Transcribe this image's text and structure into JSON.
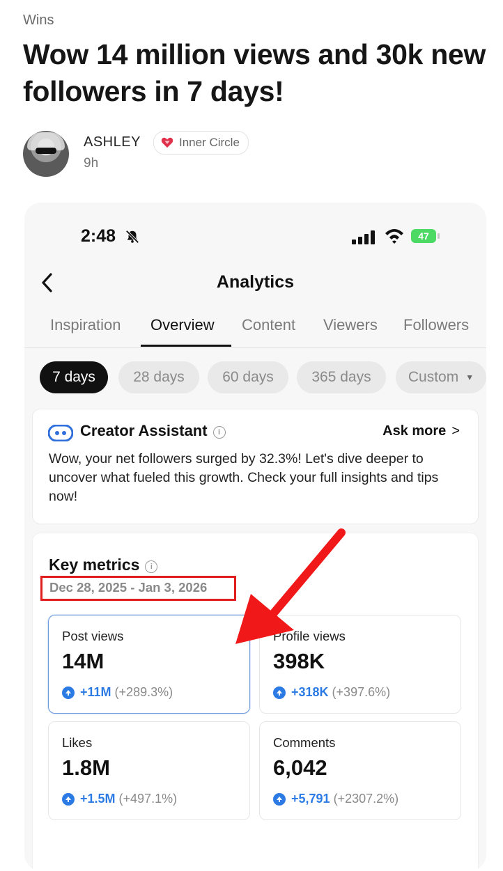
{
  "post": {
    "category": "Wins",
    "title": "Wow 14 million views and 30k new followers in 7 days!",
    "author": "ASHLEY",
    "badge": "Inner Circle",
    "time": "9h"
  },
  "phone": {
    "status": {
      "time": "2:48",
      "battery": "47"
    },
    "nav_title": "Analytics",
    "tabs": [
      "Inspiration",
      "Overview",
      "Content",
      "Viewers",
      "Followers"
    ],
    "active_tab": "Overview",
    "range_chips": [
      "7 days",
      "28 days",
      "60 days",
      "365 days",
      "Custom"
    ],
    "active_range": "7 days",
    "assistant": {
      "title": "Creator Assistant",
      "ask_more": "Ask more",
      "message": "Wow, your net followers surged by 32.3%! Let's dive deeper to uncover what fueled this growth. Check your full insights and tips now!"
    },
    "key_metrics": {
      "title": "Key metrics",
      "date_range": "Dec 28, 2025 - Jan 3, 2026",
      "tiles": [
        {
          "label": "Post views",
          "value": "14M",
          "delta": "+11M",
          "pct": "(+289.3%)",
          "selected": true
        },
        {
          "label": "Profile views",
          "value": "398K",
          "delta": "+318K",
          "pct": "(+397.6%)",
          "selected": false
        },
        {
          "label": "Likes",
          "value": "1.8M",
          "delta": "+1.5M",
          "pct": "(+497.1%)",
          "selected": false
        },
        {
          "label": "Comments",
          "value": "6,042",
          "delta": "+5,791",
          "pct": "(+2307.2%)",
          "selected": false
        }
      ]
    }
  },
  "colors": {
    "accent_blue": "#2c7be5",
    "annotation_red": "#e01e1e",
    "battery_green": "#4cd964"
  },
  "icons": [
    "back-chevron-icon",
    "bell-muted-icon",
    "signal-icon",
    "wifi-icon",
    "battery-icon",
    "heart-badge-icon",
    "creator-assistant-icon",
    "info-icon",
    "arrow-up-circle-icon"
  ]
}
